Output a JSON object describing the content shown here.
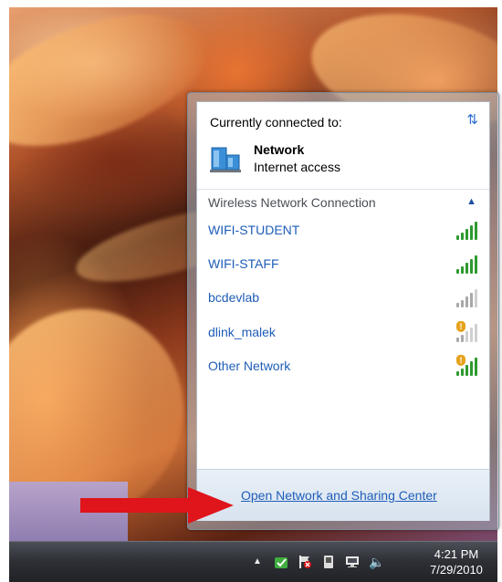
{
  "network_flyout": {
    "header": "Currently connected to:",
    "connected_network": {
      "name": "Network",
      "status": "Internet access"
    },
    "section_title": "Wireless Network Connection",
    "wireless_networks": [
      {
        "name": "WIFI-STUDENT",
        "signal_bars": 5,
        "secured": true,
        "signal_color": "#2e9a2e"
      },
      {
        "name": "WIFI-STAFF",
        "signal_bars": 5,
        "secured": true,
        "signal_color": "#2e9a2e"
      },
      {
        "name": "bcdevlab",
        "signal_bars": 4,
        "secured": true,
        "signal_color": "#a8a8a8"
      },
      {
        "name": "dlink_malek",
        "signal_bars": 2,
        "secured": false,
        "signal_color": "#a8a8a8"
      },
      {
        "name": "Other Network",
        "signal_bars": 5,
        "secured": false,
        "signal_color": "#2e9a2e"
      }
    ],
    "footer_link": "Open Network and Sharing Center"
  },
  "taskbar": {
    "time": "4:21 PM",
    "date": "7/29/2010",
    "tray_icons": [
      "show-hidden-icons-arrow",
      "green-app-icon",
      "action-center-flag-icon",
      "device-icon",
      "network-icon",
      "volume-icon"
    ]
  },
  "colors": {
    "link_blue": "#1f5db8",
    "signal_green": "#2e9a2e",
    "signal_gray": "#a8a8a8",
    "annotation_red": "#e0141b"
  }
}
